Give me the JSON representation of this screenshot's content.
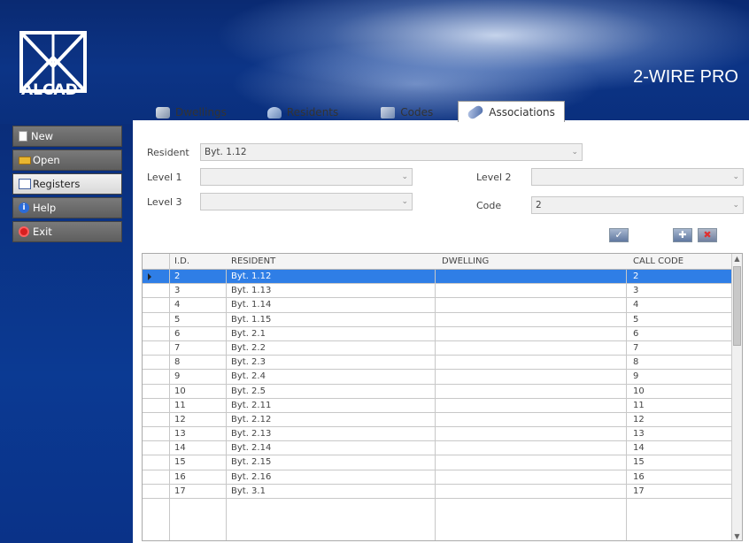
{
  "header": {
    "logo_text": "ALCAD",
    "product_title": "2-WIRE PRO"
  },
  "menu": {
    "items": [
      {
        "label": "New",
        "icon": "new-document-icon"
      },
      {
        "label": "Open",
        "icon": "folder-open-icon"
      },
      {
        "label": "Registers",
        "icon": "registers-edit-icon"
      },
      {
        "label": "Help",
        "icon": "info-icon"
      },
      {
        "label": "Exit",
        "icon": "power-exit-icon"
      }
    ],
    "active": "Registers"
  },
  "tabs": [
    {
      "label": "Dwellings",
      "icon": "dwellings-icon"
    },
    {
      "label": "Residents",
      "icon": "residents-icon"
    },
    {
      "label": "Codes",
      "icon": "codes-icon"
    },
    {
      "label": "Associations",
      "icon": "associations-link-icon"
    }
  ],
  "active_tab": "Associations",
  "form": {
    "resident_label": "Resident",
    "resident_value": "Byt. 1.12",
    "level1_label": "Level 1",
    "level1_value": "",
    "level2_label": "Level 2",
    "level2_value": "",
    "level3_label": "Level 3",
    "level3_value": "",
    "code_label": "Code",
    "code_value": "2",
    "arrow": "⌄"
  },
  "grid": {
    "columns": [
      "I.D.",
      "RESIDENT",
      "DWELLING",
      "CALL CODE"
    ],
    "rows": [
      {
        "id": "2",
        "resident": "Byt. 1.12",
        "dwelling": "",
        "call_code": "2"
      },
      {
        "id": "3",
        "resident": "Byt. 1.13",
        "dwelling": "",
        "call_code": "3"
      },
      {
        "id": "4",
        "resident": "Byt. 1.14",
        "dwelling": "",
        "call_code": "4"
      },
      {
        "id": "5",
        "resident": "Byt. 1.15",
        "dwelling": "",
        "call_code": "5"
      },
      {
        "id": "6",
        "resident": "Byt. 2.1",
        "dwelling": "",
        "call_code": "6"
      },
      {
        "id": "7",
        "resident": "Byt. 2.2",
        "dwelling": "",
        "call_code": "7"
      },
      {
        "id": "8",
        "resident": "Byt. 2.3",
        "dwelling": "",
        "call_code": "8"
      },
      {
        "id": "9",
        "resident": "Byt. 2.4",
        "dwelling": "",
        "call_code": "9"
      },
      {
        "id": "10",
        "resident": "Byt. 2.5",
        "dwelling": "",
        "call_code": "10"
      },
      {
        "id": "11",
        "resident": "Byt. 2.11",
        "dwelling": "",
        "call_code": "11"
      },
      {
        "id": "12",
        "resident": "Byt. 2.12",
        "dwelling": "",
        "call_code": "12"
      },
      {
        "id": "13",
        "resident": "Byt. 2.13",
        "dwelling": "",
        "call_code": "13"
      },
      {
        "id": "14",
        "resident": "Byt. 2.14",
        "dwelling": "",
        "call_code": "14"
      },
      {
        "id": "15",
        "resident": "Byt. 2.15",
        "dwelling": "",
        "call_code": "15"
      },
      {
        "id": "16",
        "resident": "Byt. 2.16",
        "dwelling": "",
        "call_code": "16"
      },
      {
        "id": "17",
        "resident": "Byt. 3.1",
        "dwelling": "",
        "call_code": "17"
      }
    ],
    "selected_index": 0
  },
  "colors": {
    "selection": "#2f7ee6",
    "header_bg": "#0c3486"
  }
}
